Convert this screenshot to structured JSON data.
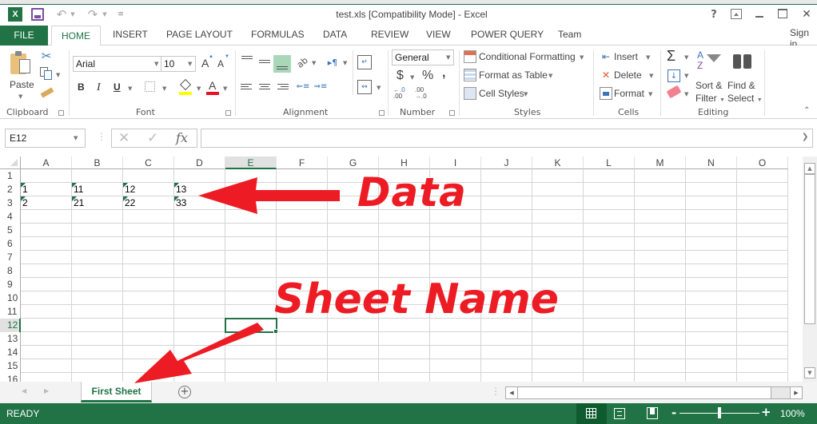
{
  "window": {
    "title": "test.xls  [Compatibility Mode] - Excel",
    "controls": {
      "help": "?",
      "ribbon_display": "⧉",
      "minimize": "–",
      "maximize": "☐",
      "close": "✕"
    },
    "quick_access": {
      "save": "save",
      "undo": "undo",
      "redo": "redo",
      "customize": "customize"
    }
  },
  "ribbon_tabs": {
    "file": "FILE",
    "items": [
      "HOME",
      "INSERT",
      "PAGE LAYOUT",
      "FORMULAS",
      "DATA",
      "REVIEW",
      "VIEW",
      "POWER QUERY",
      "Team"
    ],
    "active": "HOME",
    "sign_in": "Sign in"
  },
  "ribbon": {
    "clipboard": {
      "label": "Clipboard",
      "paste": "Paste"
    },
    "font": {
      "label": "Font",
      "font_name": "Arial",
      "font_size": "10",
      "bold": "B",
      "italic": "I",
      "underline": "U",
      "grow": "A",
      "shrink": "A",
      "fill_color": "#ffff00",
      "font_color": "#e81123",
      "font_color_letter": "A"
    },
    "alignment": {
      "label": "Alignment"
    },
    "number": {
      "label": "Number",
      "format": "General",
      "currency": "$",
      "percent": "%",
      "comma": ",",
      "inc_decimal": ".00",
      "dec_decimal": ".0"
    },
    "styles": {
      "label": "Styles",
      "conditional_formatting": "Conditional Formatting",
      "format_as_table": "Format as Table",
      "cell_styles": "Cell Styles"
    },
    "cells": {
      "label": "Cells",
      "insert": "Insert",
      "delete": "Delete",
      "format": "Format"
    },
    "editing": {
      "label": "Editing",
      "sort_filter_1": "Sort &",
      "sort_filter_2": "Filter",
      "find_select_1": "Find &",
      "find_select_2": "Select",
      "sigma": "Σ"
    }
  },
  "formula_bar": {
    "name_box": "E12",
    "fx": "fx",
    "cancel": "✕",
    "enter": "✓",
    "formula": ""
  },
  "sheet": {
    "columns": [
      "A",
      "B",
      "C",
      "D",
      "E",
      "F",
      "G",
      "H",
      "I",
      "J",
      "K",
      "L",
      "M",
      "N",
      "O"
    ],
    "rows": [
      "1",
      "2",
      "3",
      "4",
      "5",
      "6",
      "7",
      "8",
      "9",
      "10",
      "11",
      "12",
      "13",
      "14",
      "15",
      "16"
    ],
    "selected_cell": "E12",
    "selected_column": "E",
    "selected_row": "12",
    "data": [
      {
        "row": "2",
        "A": "1",
        "B": "11",
        "C": "12",
        "D": "13"
      },
      {
        "row": "3",
        "A": "2",
        "B": "21",
        "C": "22",
        "D": "33"
      }
    ]
  },
  "sheet_tabs": {
    "tabs": [
      "First Sheet"
    ],
    "active": "First Sheet",
    "add": "+"
  },
  "status_bar": {
    "status": "READY",
    "zoom": "100%",
    "zoom_minus": "-",
    "zoom_plus": "+",
    "zoom_fraction": 0.5
  },
  "annotations": {
    "data_label": "Data",
    "sheet_name_label": "Sheet Name",
    "color": "#ed1c24"
  }
}
